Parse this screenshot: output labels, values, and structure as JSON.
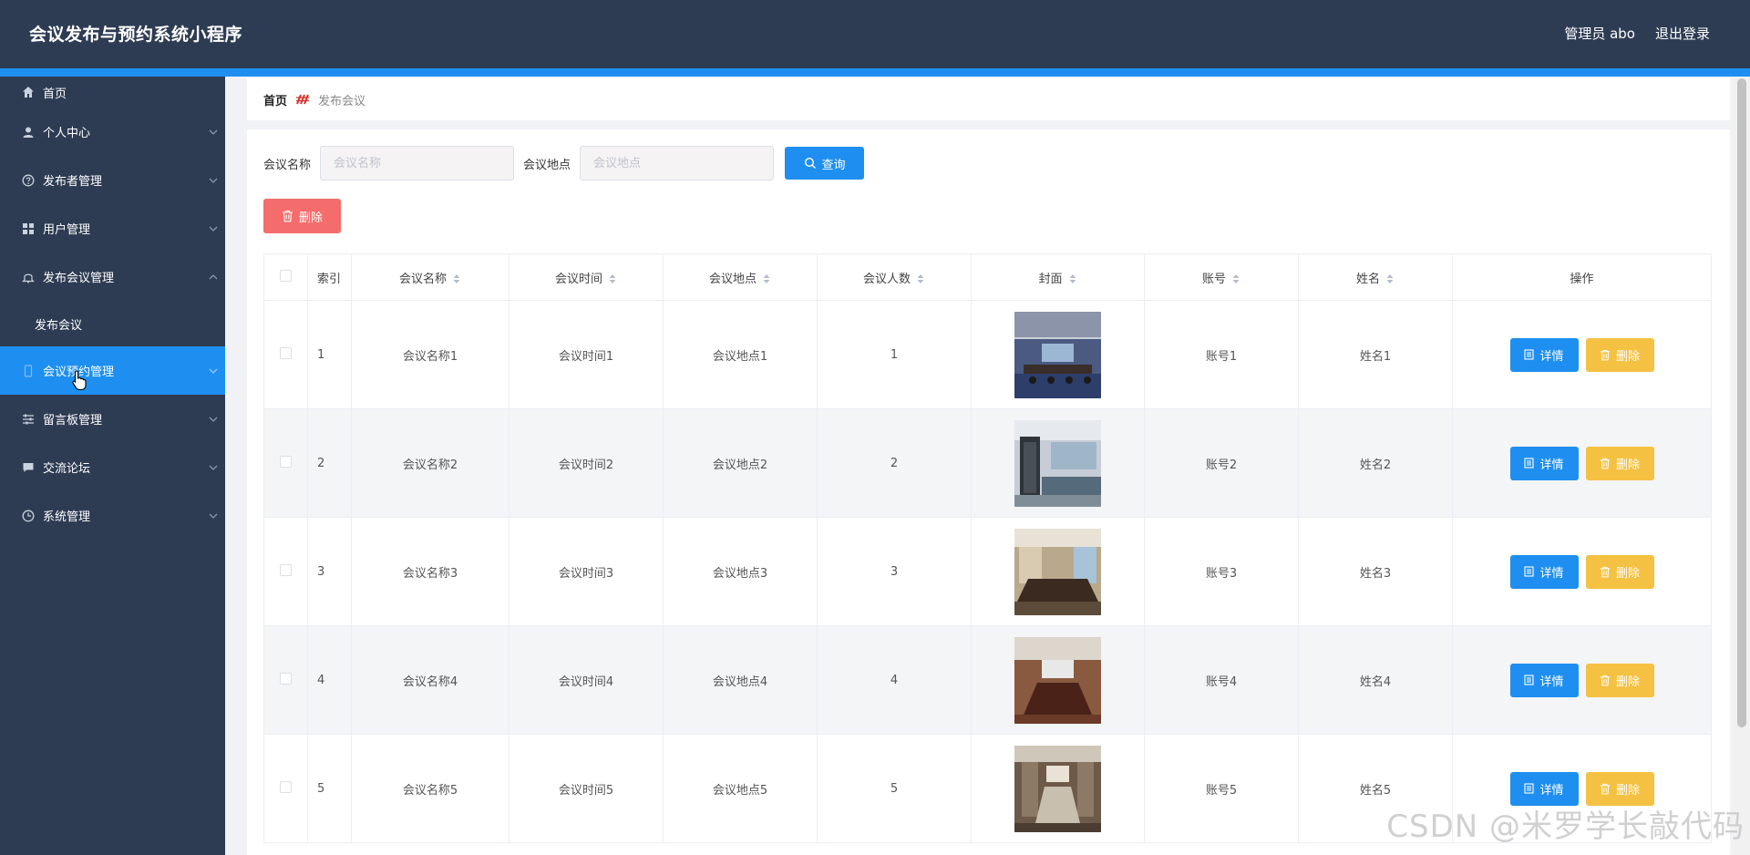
{
  "header": {
    "title": "会议发布与预约系统小程序",
    "user": "管理员 abo",
    "logout": "退出登录"
  },
  "sidebar": {
    "items": [
      {
        "label": "首页",
        "icon": "home-icon"
      },
      {
        "label": "个人中心",
        "icon": "user-icon"
      },
      {
        "label": "发布者管理",
        "icon": "help-circle-icon"
      },
      {
        "label": "用户管理",
        "icon": "grid-icon"
      },
      {
        "label": "发布会议管理",
        "icon": "bell-icon"
      },
      {
        "label": "发布会议",
        "icon": ""
      },
      {
        "label": "会议预约管理",
        "icon": "phone-icon"
      },
      {
        "label": "留言板管理",
        "icon": "sliders-icon"
      },
      {
        "label": "交流论坛",
        "icon": "chat-icon"
      },
      {
        "label": "系统管理",
        "icon": "clock-icon"
      }
    ]
  },
  "breadcrumb": {
    "home": "首页",
    "current": "发布会议"
  },
  "search": {
    "name_label": "会议名称",
    "name_placeholder": "会议名称",
    "name_value": "",
    "place_label": "会议地点",
    "place_placeholder": "会议地点",
    "place_value": "",
    "query_label": "查询"
  },
  "toolbar": {
    "delete_label": "删除"
  },
  "table": {
    "headers": [
      "索引",
      "会议名称",
      "会议时间",
      "会议地点",
      "会议人数",
      "封面",
      "账号",
      "姓名",
      "操作"
    ],
    "detail_label": "详情",
    "delete_label": "删除",
    "rows": [
      {
        "index": "1",
        "name": "会议名称1",
        "time": "会议时间1",
        "place": "会议地点1",
        "count": "1",
        "account": "账号1",
        "person": "姓名1"
      },
      {
        "index": "2",
        "name": "会议名称2",
        "time": "会议时间2",
        "place": "会议地点2",
        "count": "2",
        "account": "账号2",
        "person": "姓名2"
      },
      {
        "index": "3",
        "name": "会议名称3",
        "time": "会议时间3",
        "place": "会议地点3",
        "count": "3",
        "account": "账号3",
        "person": "姓名3"
      },
      {
        "index": "4",
        "name": "会议名称4",
        "time": "会议时间4",
        "place": "会议地点4",
        "count": "4",
        "account": "账号4",
        "person": "姓名4"
      },
      {
        "index": "5",
        "name": "会议名称5",
        "time": "会议时间5",
        "place": "会议地点5",
        "count": "5",
        "account": "账号5",
        "person": "姓名5"
      }
    ]
  },
  "watermark": "CSDN @米罗学长敲代码",
  "colors": {
    "sidebar": "#2e3c53",
    "accent": "#1e8ff0",
    "danger": "#f56c6c",
    "warning": "#f5c142"
  }
}
